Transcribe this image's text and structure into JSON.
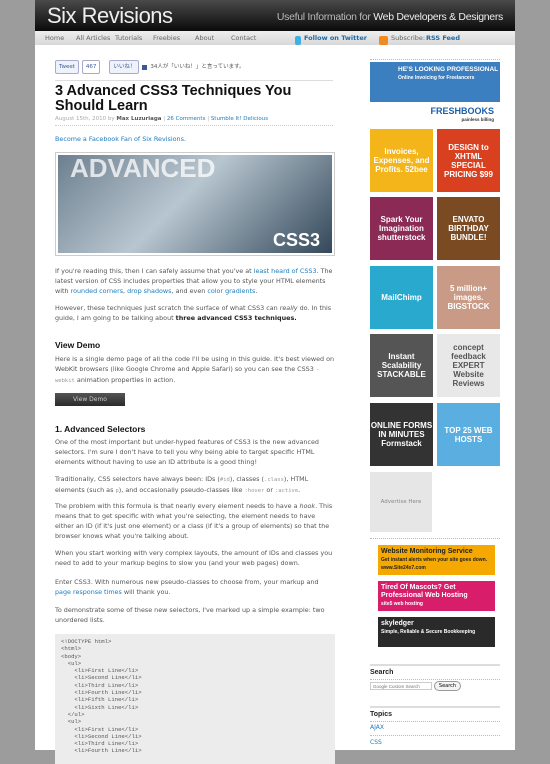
{
  "header": {
    "logo": "Six Revisions",
    "tagline_pre": "Useful Information for ",
    "tagline_bold": "Web Developers & Designers"
  },
  "nav": {
    "items": [
      "Home",
      "All Articles",
      "Tutorials",
      "Freebies",
      "About",
      "Contact"
    ],
    "twitter": "Follow on Twitter",
    "subscribe": "Subscribe:",
    "rss": "RSS Feed"
  },
  "social": {
    "tweet": "Tweet",
    "tweet_count": "467",
    "like": "いいね！",
    "like_text": "34人が「いいね！」と言っています。"
  },
  "article": {
    "title": "3 Advanced CSS3 Techniques You Should Learn",
    "date": "August 15th, 2010 by ",
    "author": "Max Luzuriaga",
    "comments": "26 Comments",
    "stumble": "Stumble It!",
    "delicious": "Delicious",
    "fan": "Become a Facebook Fan of Six Revisions.",
    "hero_text1": "ADVANCED",
    "hero_text2": "CSS3",
    "p1a": "If you're reading this, then I can safely assume that you've at ",
    "p1l1": "least heard of CSS3",
    "p1b": ". The latest version of CSS includes properties that allow you to style your HTML elements with ",
    "p1l2": "rounded corners",
    "p1c": ", ",
    "p1l3": "drop shadows",
    "p1d": ", and even ",
    "p1l4": "color gradients",
    "p1e": ".",
    "p2a": "However, these techniques just scratch the surface of what CSS3 can ",
    "p2i": "really",
    "p2b": " do. In this guide, I am going to be talking about ",
    "p2s": "three advanced CSS3 techniques.",
    "h_demo": "View Demo",
    "p3a": "Here is a single demo page of all the code I'll be using in this guide. It's best viewed on WebKit browsers (like Google Chrome and Apple Safari) so you can see the CSS3 ",
    "p3c": "-webkit",
    "p3b": " animation properties in action.",
    "demo_btn": "View Demo",
    "h_sel": "1. Advanced Selectors",
    "p4": "One of the most important but under-hyped features of CSS3 is the new advanced selectors. I'm sure I don't have to tell you why being able to target specific HTML elements without having to use an ID attribute is a good thing!",
    "p5a": "Traditionally, CSS selectors have always been: IDs (",
    "p5c1": "#id",
    "p5b": "), classes (",
    "p5c2": ".class",
    "p5c": "), HTML elements (such as ",
    "p5c3": "p",
    "p5d": "), and occasionally pseudo-classes like ",
    "p5c4": ":hover",
    "p5e": " or ",
    "p5c5": ":active",
    "p5f": ".",
    "p6a": "The problem with this formula is that nearly every element needs to have a ",
    "p6i": "hook",
    "p6b": ". This means that to get specific with what you're selecting, the element needs to have either an ID (if it's just one element) or a class (if it's a group of elements) so that the browser knows what you're talking about.",
    "p7": "When you start working with very complex layouts, the amount of IDs and classes you need to add to your markup begins to slow you (and your web pages) down.",
    "p8a": "Enter CSS3. With numerous new pseudo-classes to choose from, your markup and ",
    "p8l": "page response times",
    "p8b": " will thank you.",
    "p9": "To demonstrate some of these new selectors, I've marked up a simple example: two unordered lists.",
    "code": "<!DOCTYPE html>\n<html>\n<body>\n  <ul>\n    <li>First Line</li>\n    <li>Second Line</li>\n    <li>Third Line</li>\n    <li>Fourth Line</li>\n    <li>Fifth Line</li>\n    <li>Sixth Line</li>\n  </ul>\n  <ul>\n    <li>First Line</li>\n    <li>Second Line</li>\n    <li>Third Line</li>\n    <li>Fourth Line</li>"
  },
  "sidebar": {
    "top_ad": {
      "line1": "HE'S LOOKING PROFESSIONAL",
      "line2": "Online Invoicing for Freelancers",
      "brand": "FRESHBOOKS",
      "sub": "painless billing"
    },
    "ads": [
      {
        "text": "Invoices, Expenses, and Profits. 52bee",
        "bg": "#f3b51a"
      },
      {
        "text": "DESIGN to XHTML SPECIAL PRICING $99",
        "bg": "#d8401f"
      },
      {
        "text": "Spark Your Imagination shutterstock",
        "bg": "#8a2a55"
      },
      {
        "text": "ENVATO BIRTHDAY BUNDLE!",
        "bg": "#7a4a22"
      },
      {
        "text": "MailChimp",
        "bg": "#2aa9cf"
      },
      {
        "text": "5 million+ images. BIGSTOCK",
        "bg": "#c99a86"
      },
      {
        "text": "Instant Scalability STACKABLE",
        "bg": "#555555"
      },
      {
        "text": "concept feedback EXPERT Website Reviews",
        "bg": "#e8e8e8"
      },
      {
        "text": "ONLINE FORMS IN MINUTES Formstack",
        "bg": "#333333"
      },
      {
        "text": "TOP 25 WEB HOSTS",
        "bg": "#5aaee0"
      }
    ],
    "advertise": "Advertise Here",
    "banners": [
      {
        "title": "Website Monitoring Service",
        "sub": "Get instant alerts when your site goes down.",
        "extra": "www.Site24x7.com",
        "bg": "#f5a800"
      },
      {
        "title": "Tired Of Mascots? Get Professional Web Hosting",
        "sub": "site5 web hosting",
        "extra": "",
        "bg": "#d81d6b"
      },
      {
        "title": "skyledger",
        "sub": "Simple, Reliable & Secure Bookkeeping",
        "extra": "",
        "bg": "#2a2a2a"
      }
    ],
    "search_title": "Search",
    "search_placeholder": "Google Custom Search",
    "search_btn": "Search",
    "topics_title": "Topics",
    "topics": [
      "AJAX",
      "CSS"
    ]
  },
  "colors": {
    "link": "#1d7bbd",
    "header": "#111111"
  }
}
